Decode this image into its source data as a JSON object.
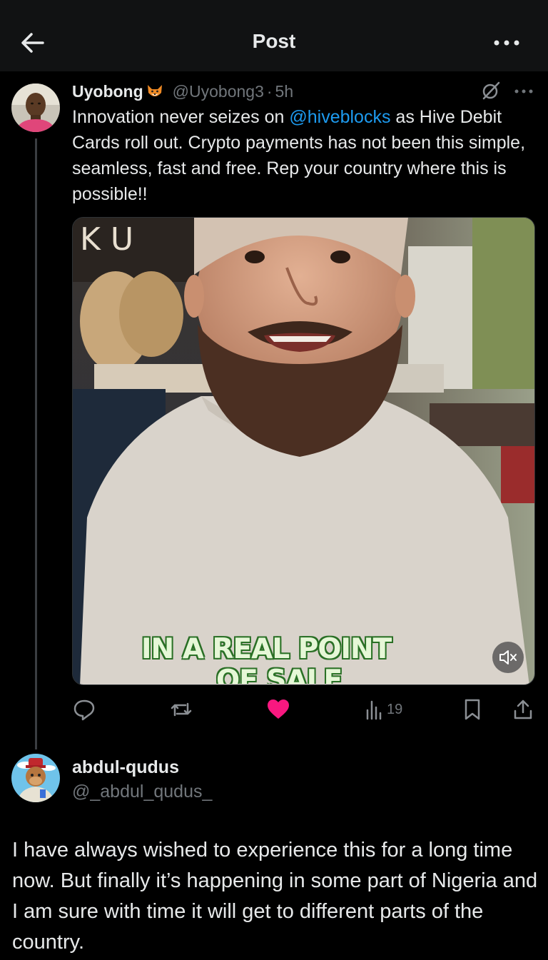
{
  "header": {
    "title": "Post"
  },
  "post": {
    "author_name": "Uyobong",
    "author_handle": "@Uyobong3",
    "separator": "·",
    "time": "5h",
    "text_before": "Innovation never seizes on ",
    "mention": "@hiveblocks",
    "text_after": "  as Hive Debit Cards roll out. Crypto payments has not been this simple, seamless, fast and free. Rep your country where this is possible!!",
    "media": {
      "caption_line1": "IN A REAL POINT",
      "caption_line2": "OF SALE",
      "letters": "K U",
      "muted": true
    },
    "actions": {
      "liked": true,
      "views": "19"
    }
  },
  "reply": {
    "author_name": "abdul-qudus",
    "author_handle": "@_abdul_qudus_",
    "text": "I have always wished to experience this for a long time now. But finally it’s happening in some part of Nigeria and I am sure with time it will get to different parts of the country."
  },
  "colors": {
    "background": "#000000",
    "header": "#111213",
    "text": "#e7e9ea",
    "muted": "#71767b",
    "link": "#1d9bf0",
    "like": "#f91880"
  },
  "icons": [
    "back-arrow-icon",
    "more-icon",
    "grok-icon",
    "reply-icon",
    "repost-icon",
    "heart-icon",
    "views-icon",
    "bookmark-icon",
    "share-icon",
    "mute-icon"
  ]
}
